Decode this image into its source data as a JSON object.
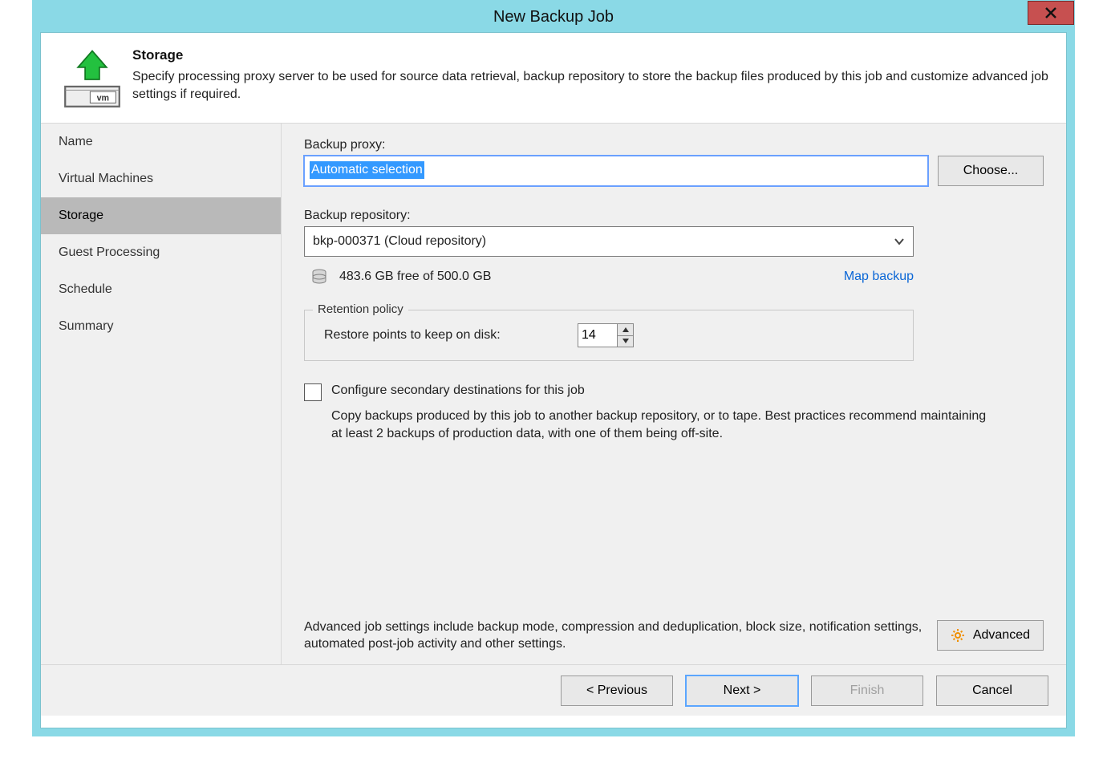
{
  "window": {
    "title": "New Backup Job"
  },
  "header": {
    "title": "Storage",
    "description": "Specify processing proxy server to be used for source data retrieval, backup repository to store the backup files produced by this job and customize advanced job settings if required."
  },
  "sidebar": {
    "steps": [
      {
        "label": "Name",
        "active": false
      },
      {
        "label": "Virtual Machines",
        "active": false
      },
      {
        "label": "Storage",
        "active": true
      },
      {
        "label": "Guest Processing",
        "active": false
      },
      {
        "label": "Schedule",
        "active": false
      },
      {
        "label": "Summary",
        "active": false
      }
    ]
  },
  "main": {
    "backup_proxy": {
      "label": "Backup proxy:",
      "value": "Automatic selection",
      "choose_button": "Choose..."
    },
    "backup_repository": {
      "label": "Backup repository:",
      "selected": "bkp-000371 (Cloud repository)",
      "free_text": "483.6 GB free of 500.0 GB",
      "map_backup_link": "Map backup"
    },
    "retention": {
      "legend": "Retention policy",
      "restore_points_label": "Restore points to keep on disk:",
      "restore_points_value": "14"
    },
    "secondary": {
      "checkbox_label": "Configure secondary destinations for this job",
      "hint": "Copy backups produced by this job to another backup repository, or to tape. Best practices recommend maintaining at least 2 backups of production data, with one of them being off-site."
    },
    "advanced": {
      "text": "Advanced job settings include backup mode, compression and deduplication, block size, notification settings, automated post-job activity and other settings.",
      "button": "Advanced"
    }
  },
  "footer": {
    "previous": "< Previous",
    "next": "Next >",
    "finish": "Finish",
    "cancel": "Cancel"
  }
}
